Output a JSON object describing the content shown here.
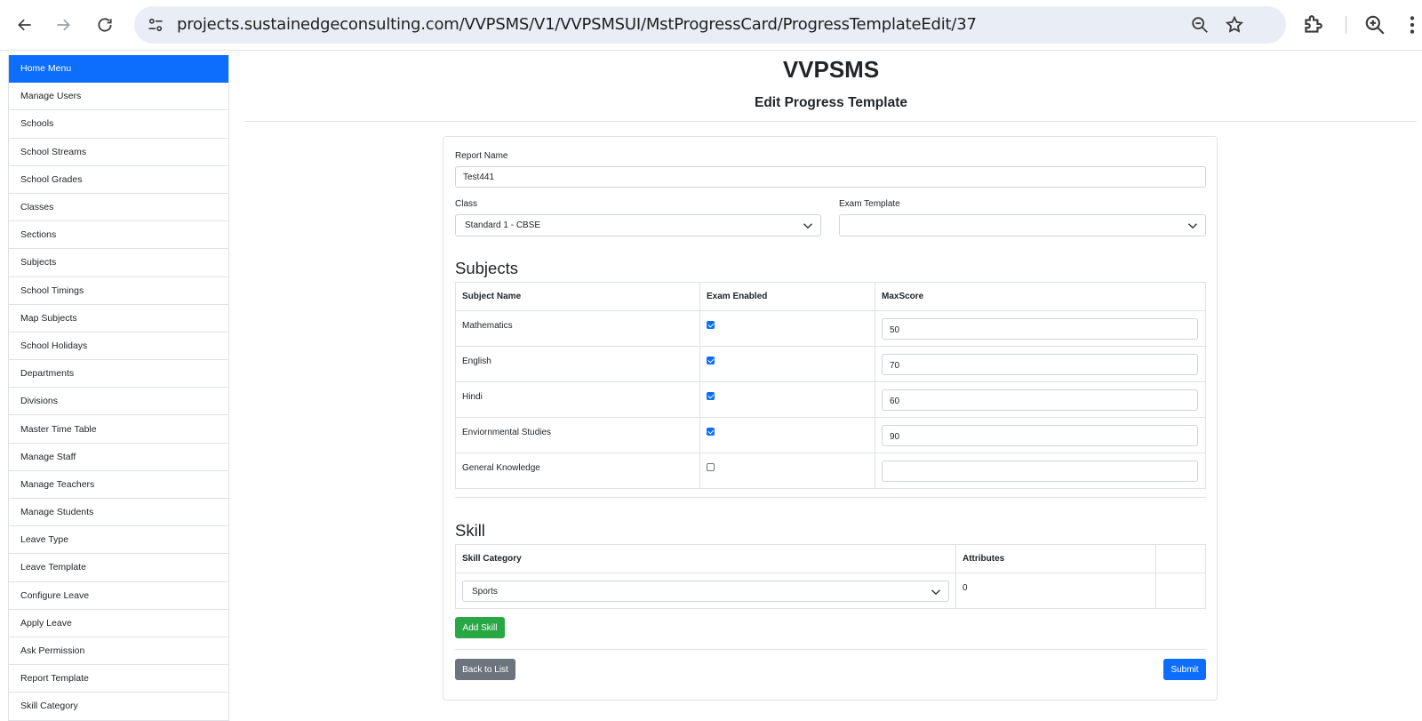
{
  "browser": {
    "url": "projects.sustainedgeconsulting.com/VVPSMS/V1/VVPSMSUI/MstProgressCard/ProgressTemplateEdit/37"
  },
  "sidebar": {
    "items": [
      {
        "label": "Home Menu",
        "active": true
      },
      {
        "label": "Manage Users"
      },
      {
        "label": "Schools"
      },
      {
        "label": "School Streams"
      },
      {
        "label": "School Grades"
      },
      {
        "label": "Classes"
      },
      {
        "label": "Sections"
      },
      {
        "label": "Subjects"
      },
      {
        "label": "School Timings"
      },
      {
        "label": "Map Subjects"
      },
      {
        "label": "School Holidays"
      },
      {
        "label": "Departments"
      },
      {
        "label": "Divisions"
      },
      {
        "label": "Master Time Table"
      },
      {
        "label": "Manage Staff"
      },
      {
        "label": "Manage Teachers"
      },
      {
        "label": "Manage Students"
      },
      {
        "label": "Leave Type"
      },
      {
        "label": "Leave Template"
      },
      {
        "label": "Configure Leave"
      },
      {
        "label": "Apply Leave"
      },
      {
        "label": "Ask Permission"
      },
      {
        "label": "Report Template"
      },
      {
        "label": "Skill Category"
      }
    ]
  },
  "header": {
    "title": "VVPSMS",
    "subtitle": "Edit Progress Template"
  },
  "form": {
    "report_name_label": "Report Name",
    "report_name_value": "Test441",
    "class_label": "Class",
    "class_value": "Standard 1 - CBSE",
    "exam_template_label": "Exam Template",
    "exam_template_value": ""
  },
  "subjects": {
    "heading": "Subjects",
    "columns": [
      "Subject Name",
      "Exam Enabled",
      "MaxScore"
    ],
    "rows": [
      {
        "name": "Mathematics",
        "enabled": true,
        "max_score": "50"
      },
      {
        "name": "English",
        "enabled": true,
        "max_score": "70"
      },
      {
        "name": "Hindi",
        "enabled": true,
        "max_score": "60"
      },
      {
        "name": "Enviornmental Studies",
        "enabled": true,
        "max_score": "90"
      },
      {
        "name": "General Knowledge",
        "enabled": false,
        "max_score": ""
      }
    ]
  },
  "skill": {
    "heading": "Skill",
    "columns": [
      "Skill Category",
      "Attributes",
      ""
    ],
    "rows": [
      {
        "category": "Sports",
        "attributes": "0"
      }
    ],
    "add_button": "Add Skill"
  },
  "actions": {
    "back_label": "Back to List",
    "submit_label": "Submit"
  },
  "colors": {
    "primary": "#0d6efd",
    "success": "#28a745",
    "secondary": "#6c757d"
  }
}
